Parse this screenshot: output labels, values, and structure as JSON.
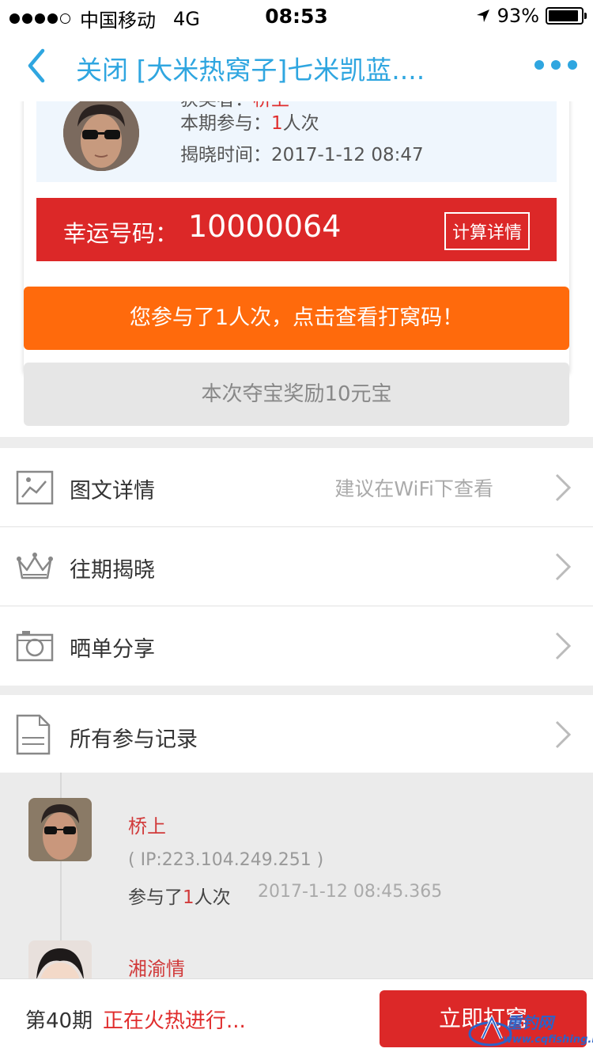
{
  "status_bar": {
    "carrier": "中国移动",
    "network": "4G",
    "time": "08:53",
    "battery": "93%",
    "battery_level": 0.93
  },
  "nav": {
    "title": "关闭 [大米热窝子]七米凯蓝....",
    "accent_color": "#2fa6e0"
  },
  "winner": {
    "name_label": "获奖者：",
    "name_value": "桥上",
    "participation_label": "本期参与：",
    "participation_count": "1",
    "participation_unit": "人次",
    "reveal_label": "揭晓时间：",
    "reveal_time": "2017-1-12 08:47"
  },
  "lucky": {
    "label": "幸运号码：",
    "number": "10000064",
    "calc_button": "计算详情"
  },
  "buttons": {
    "view_codes": "您参与了1人次，点击查看打窝码！",
    "reward": "本次夺宝奖励10元宝"
  },
  "menu": [
    {
      "icon": "image-icon",
      "label": "图文详情",
      "hint": "建议在WiFi下查看"
    },
    {
      "icon": "crown-icon",
      "label": "往期揭晓",
      "hint": ""
    },
    {
      "icon": "camera-icon",
      "label": "晒单分享",
      "hint": ""
    }
  ],
  "records_header": {
    "icon": "document-icon",
    "label": "所有参与记录"
  },
  "records": [
    {
      "name": "桥上",
      "ip": "( IP:223.104.249.251 )",
      "join_prefix": "参与了",
      "join_count": "1",
      "join_suffix": "人次",
      "time": "2017-1-12 08:45.365"
    },
    {
      "name": "湘渝情"
    }
  ],
  "bottom": {
    "period": "第40期",
    "status": "正在火热进行...",
    "join_button": "立即打窝"
  },
  "watermark": {
    "text": "重钓网",
    "url": "www.cqfishing.net"
  }
}
